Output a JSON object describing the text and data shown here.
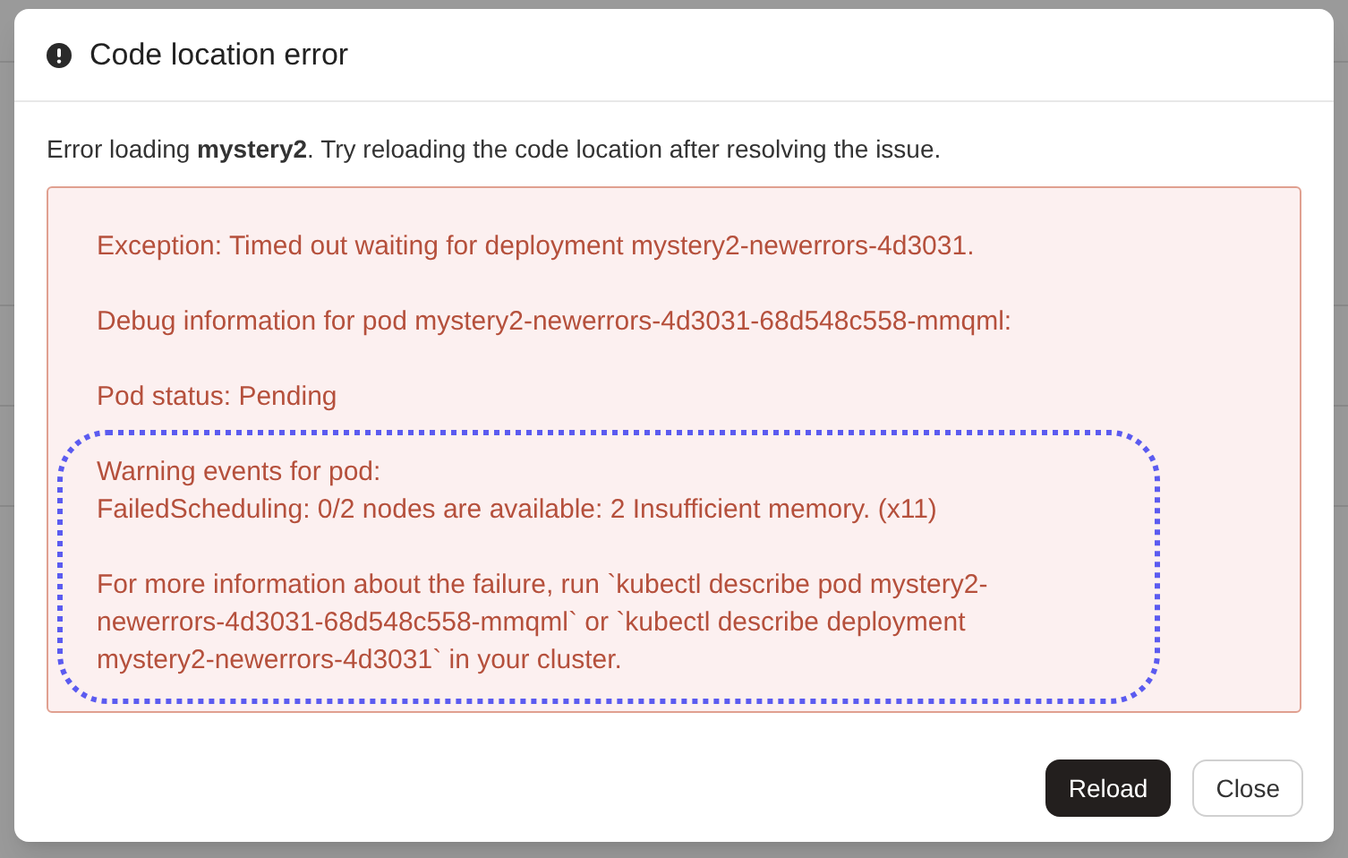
{
  "dialog": {
    "title": "Code location error",
    "message": "Error loading **mystery2**. Try reloading the code location after resolving the issue.",
    "error_paragraphs": [
      [
        "Exception: Timed out waiting for deployment mystery2-newerrors-4d3031."
      ],
      [
        "Debug information for pod mystery2-newerrors-4d3031-68d548c558-mmqml:"
      ],
      [
        "Pod status: Pending"
      ],
      [
        "Warning events for pod:",
        "FailedScheduling: 0/2 nodes are available: 2 Insufficient memory. (x11)"
      ],
      [
        "For more information about the failure, run `kubectl describe pod mystery2-",
        "newerrors-4d3031-68d548c558-mmqml` or `kubectl describe deployment",
        "mystery2-newerrors-4d3031` in your cluster."
      ]
    ],
    "buttons": [
      {
        "label": "Reload",
        "kind": "primary"
      },
      {
        "label": "Close",
        "kind": "secondary"
      }
    ]
  }
}
